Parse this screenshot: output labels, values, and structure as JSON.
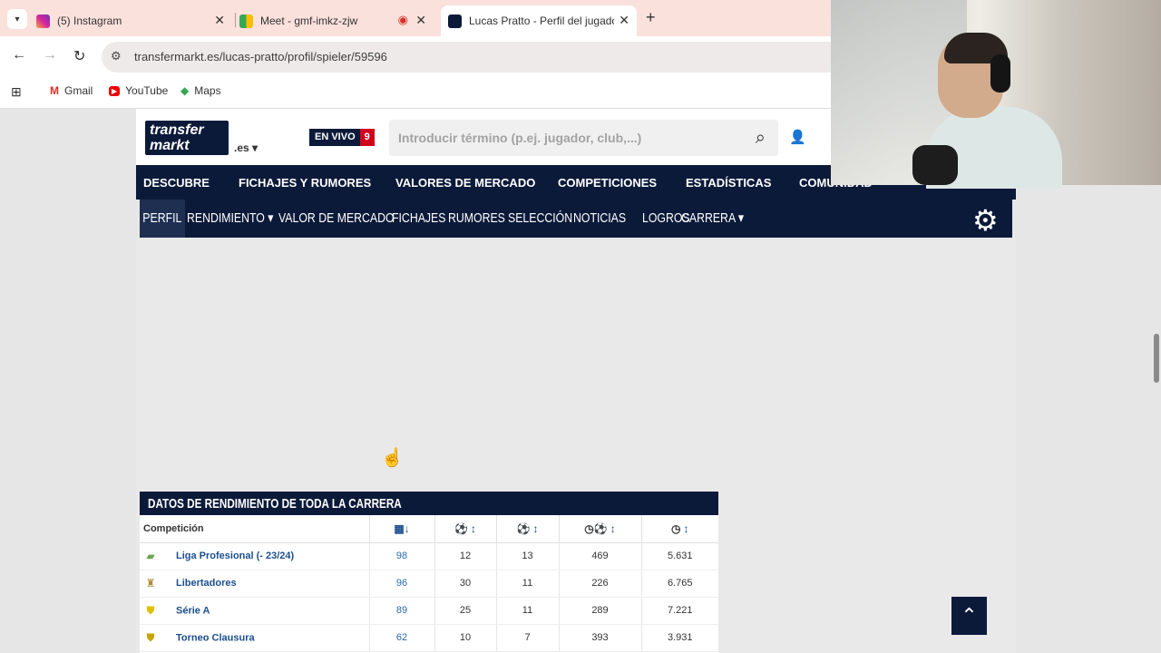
{
  "browser": {
    "tabs": [
      {
        "title": "(5) Instagram",
        "icon": "instagram-icon",
        "close": "✕"
      },
      {
        "title": "Meet - gmf-imkz-zjw",
        "icon": "meet-icon",
        "close": "✕"
      },
      {
        "title": "Lucas Pratto - Perfil del jugador",
        "icon": "transfermarkt-icon",
        "close": "✕"
      }
    ],
    "new_tab": "+",
    "url": "transfermarkt.es/lucas-pratto/profil/spieler/59596",
    "bookmarks": [
      "Gmail",
      "YouTube",
      "Maps"
    ]
  },
  "site": {
    "logo_line1": "transfer",
    "logo_line2": "markt",
    "tld": ".es ▾",
    "live_label": "EN VIVO",
    "live_count": "9",
    "search_placeholder": "Introducir término (p.ej. jugador, club,...)",
    "main_nav": [
      "DESCUBRE",
      "FICHAJES Y RUMORES",
      "VALORES DE MERCADO",
      "COMPETICIONES",
      "ESTADÍSTICAS",
      "COMUNIDAD"
    ],
    "sub_nav": [
      "PERFIL",
      "RENDIMIENTO ▾",
      "VALOR DE MERCADO",
      "FICHAJES",
      "RUMORES",
      "SELECCIÓN",
      "NOTICIAS",
      "LOGROS",
      "CARRERA ▾"
    ]
  },
  "performance": {
    "title": "DATOS DE RENDIMIENTO DE TODA LA CARRERA",
    "columns": {
      "competition": "Competición"
    },
    "rows": [
      {
        "competition": "Liga Profesional (- 23/24)",
        "apps": "98",
        "goals": "12",
        "assists": "13",
        "min_per_goal": "469",
        "minutes": "5.631",
        "crest_color": "#6aa84f"
      },
      {
        "competition": "Libertadores",
        "apps": "96",
        "goals": "30",
        "assists": "11",
        "min_per_goal": "226",
        "minutes": "6.765",
        "crest_color": "#b08a3a"
      },
      {
        "competition": "Série A",
        "apps": "89",
        "goals": "25",
        "assists": "11",
        "min_per_goal": "289",
        "minutes": "7.221",
        "crest_color": "#e0c000"
      },
      {
        "competition": "Torneo Clausura",
        "apps": "62",
        "goals": "10",
        "assists": "7",
        "min_per_goal": "393",
        "minutes": "3.931",
        "crest_color": "#c9a400"
      }
    ]
  }
}
